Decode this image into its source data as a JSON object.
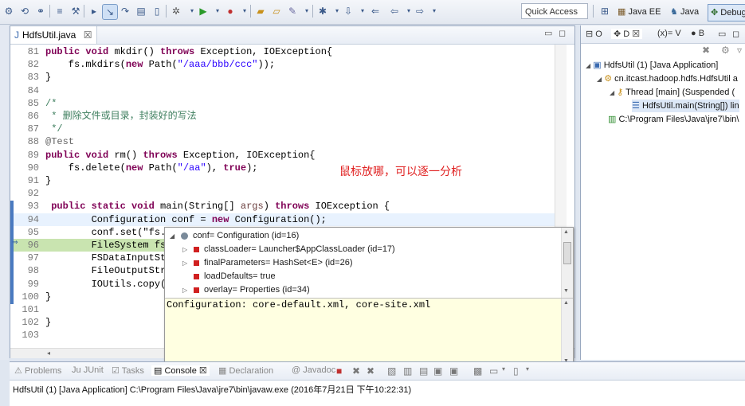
{
  "toolbar": {
    "quick_access": "Quick Access",
    "perspectives": [
      "Java EE",
      "Java",
      "Debug"
    ]
  },
  "editor": {
    "tab_title": "HdfsUtil.java",
    "lines": [
      {
        "n": "81",
        "tokens": [
          [
            "kw",
            "public "
          ],
          [
            "kw",
            "void "
          ],
          [
            "",
            "mkdir() "
          ],
          [
            "kw",
            "throws "
          ],
          [
            "",
            "Exception, IOException{"
          ]
        ]
      },
      {
        "n": "82",
        "tokens": [
          [
            "",
            "    fs.mkdirs("
          ],
          [
            "kw",
            "new "
          ],
          [
            "",
            "Path("
          ],
          [
            "str",
            "\"/aaa/bbb/ccc\""
          ],
          [
            "",
            "));"
          ]
        ]
      },
      {
        "n": "83",
        "tokens": [
          [
            "",
            "}"
          ]
        ]
      },
      {
        "n": "84",
        "tokens": [
          [
            "",
            ""
          ]
        ]
      },
      {
        "n": "85",
        "tokens": [
          [
            "cmt",
            "/*"
          ]
        ]
      },
      {
        "n": "86",
        "tokens": [
          [
            "cmt",
            " * 删除文件或目录，封装好的写法"
          ]
        ]
      },
      {
        "n": "87",
        "tokens": [
          [
            "cmt",
            " */"
          ]
        ]
      },
      {
        "n": "88",
        "tokens": [
          [
            "ann",
            "@Test"
          ]
        ]
      },
      {
        "n": "89",
        "tokens": [
          [
            "kw",
            "public "
          ],
          [
            "kw",
            "void "
          ],
          [
            "",
            "rm() "
          ],
          [
            "kw",
            "throws "
          ],
          [
            "",
            "Exception, IOException{"
          ]
        ]
      },
      {
        "n": "90",
        "tokens": [
          [
            "",
            "    fs.delete("
          ],
          [
            "kw",
            "new "
          ],
          [
            "",
            "Path("
          ],
          [
            "str",
            "\"/aa\""
          ],
          [
            "",
            "), "
          ],
          [
            "kw",
            "true"
          ],
          [
            "",
            ");"
          ]
        ]
      },
      {
        "n": "91",
        "tokens": [
          [
            "",
            "}"
          ]
        ]
      },
      {
        "n": "92",
        "tokens": [
          [
            "",
            ""
          ]
        ]
      },
      {
        "n": "93",
        "tokens": [
          [
            "kw",
            " public "
          ],
          [
            "kw",
            "static "
          ],
          [
            "kw",
            "void "
          ],
          [
            "",
            "main(String[] "
          ],
          [
            "param",
            "args"
          ],
          [
            "",
            ") "
          ],
          [
            "kw",
            "throws "
          ],
          [
            "",
            "IOException {"
          ]
        ]
      },
      {
        "n": "94",
        "tokens": [
          [
            "",
            "        Configuration conf = "
          ],
          [
            "kw",
            "new "
          ],
          [
            "",
            "Configuration();"
          ]
        ]
      },
      {
        "n": "95",
        "tokens": [
          [
            "",
            "        conf.set(\"fs.d"
          ]
        ]
      },
      {
        "n": "96",
        "tokens": [
          [
            "",
            "        FileSystem fs "
          ]
        ]
      },
      {
        "n": "97",
        "tokens": [
          [
            "",
            "        FSDataInputStr"
          ]
        ]
      },
      {
        "n": "98",
        "tokens": [
          [
            "",
            "        FileOutputStre"
          ]
        ]
      },
      {
        "n": "99",
        "tokens": [
          [
            "",
            "        IOUtils.copy(i"
          ]
        ]
      },
      {
        "n": "100",
        "tokens": [
          [
            "",
            "}"
          ]
        ]
      },
      {
        "n": "101",
        "tokens": [
          [
            "",
            ""
          ]
        ]
      },
      {
        "n": "102",
        "tokens": [
          [
            "",
            "}"
          ]
        ]
      },
      {
        "n": "103",
        "tokens": [
          [
            "",
            ""
          ]
        ]
      }
    ],
    "note": "鼠标放哪，可以逐一分析"
  },
  "popup": {
    "rows": [
      {
        "twisty": "◢",
        "kind": "local",
        "text": "conf= Configuration  (id=16)"
      },
      {
        "twisty": "▷",
        "kind": "field",
        "text": "classLoader= Launcher$AppClassLoader  (id=17)"
      },
      {
        "twisty": "▷",
        "kind": "field",
        "text": "finalParameters= HashSet<E>  (id=26)"
      },
      {
        "twisty": "",
        "kind": "field",
        "text": "loadDefaults= true"
      },
      {
        "twisty": "▷",
        "kind": "field",
        "text": "overlay= Properties  (id=34)"
      }
    ],
    "detail": "Configuration: core-default.xml, core-site.xml"
  },
  "debug_view": {
    "tabs": [
      "O",
      "D",
      "V",
      "B"
    ],
    "rows": [
      "HdfsUtil (1) [Java Application]",
      "cn.itcast.hadoop.hdfs.HdfsUtil a",
      "Thread [main] (Suspended (",
      "HdfsUtil.main(String[]) lin",
      "C:\\Program Files\\Java\\jre7\\bin\\"
    ]
  },
  "console": {
    "tabs": [
      "Problems",
      "JUnit",
      "Tasks",
      "Console",
      "Declaration",
      "Javadoc"
    ],
    "line": "HdfsUtil (1) [Java Application] C:\\Program Files\\Java\\jre7\\bin\\javaw.exe (2016年7月21日 下午10:22:31)"
  }
}
